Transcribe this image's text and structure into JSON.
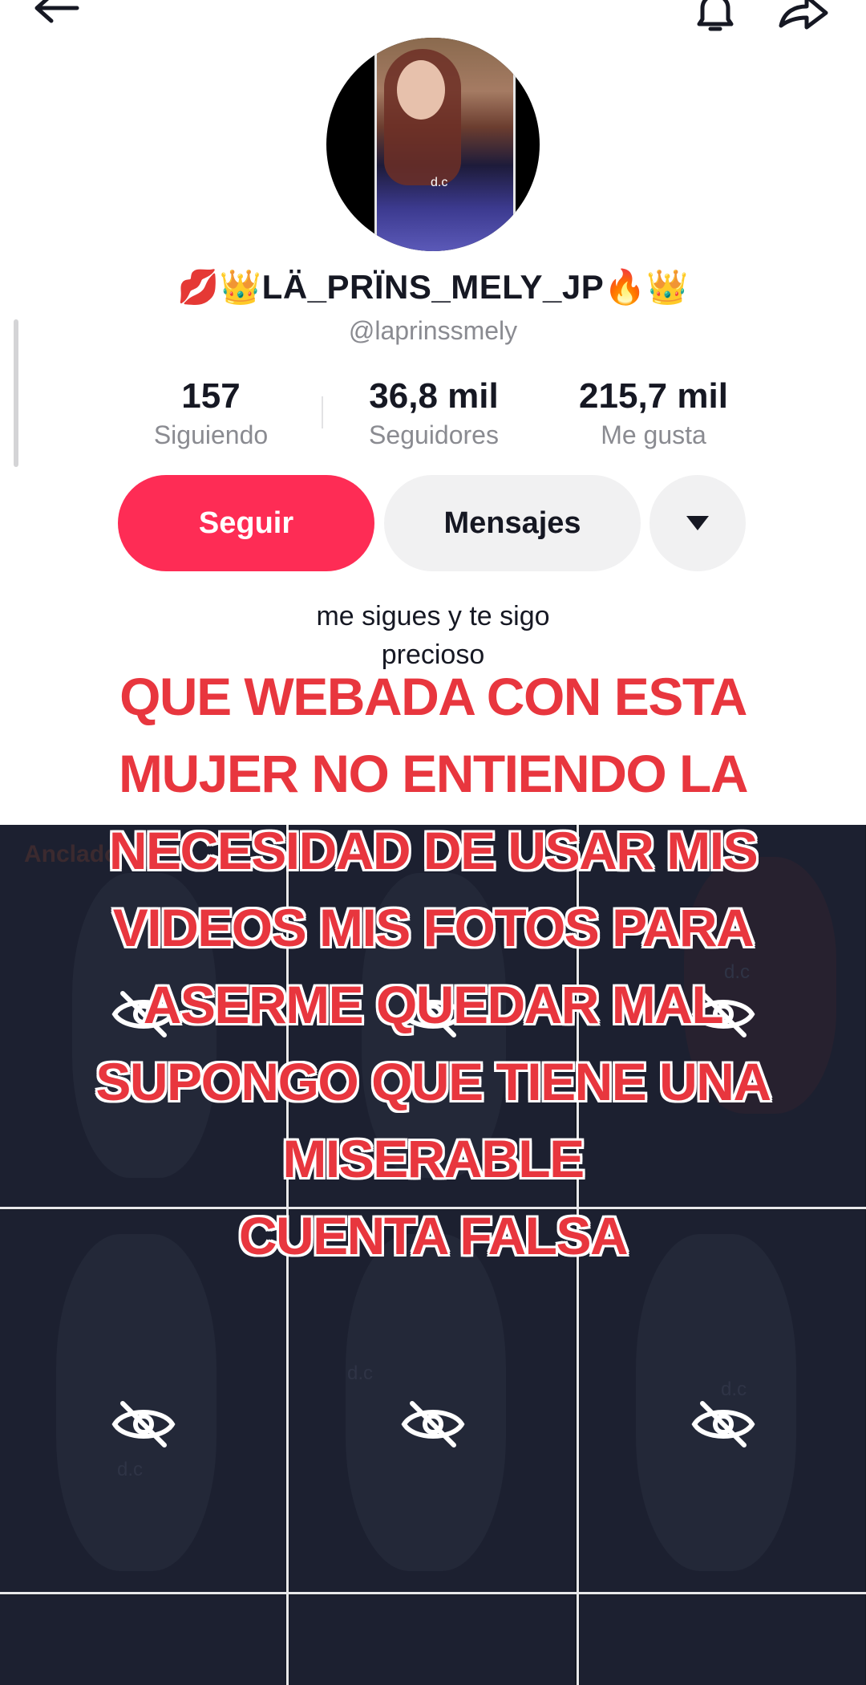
{
  "profile": {
    "display_name": "💋👑LÄ_PRÏNS_MELY_JP🔥👑",
    "username": "@laprinssmely",
    "avatar_watermark": "d.c"
  },
  "stats": [
    {
      "value": "157",
      "label": "Siguiendo"
    },
    {
      "value": "36,8 mil",
      "label": "Seguidores"
    },
    {
      "value": "215,7 mil",
      "label": "Me gusta"
    }
  ],
  "actions": {
    "follow_label": "Seguir",
    "message_label": "Mensajes",
    "more_icon": "triangle-down-icon"
  },
  "bio": [
    "me sigues y te sigo",
    "precioso"
  ],
  "grid": {
    "pinned_label": "Anclado",
    "hidden_icon": "eye-slash-icon",
    "watermark": "d.c"
  },
  "overlay": {
    "lines": [
      "QUE WEBADA CON ESTA",
      "MUJER NO ENTIENDO LA",
      "NECESIDAD DE USAR MIS",
      "VIDEOS MIS FOTOS PARA",
      "ASERME QUEDAR MAL",
      "SUPONGO QUE TIENE UNA",
      "MISERABLE",
      "CUENTA FALSA"
    ]
  },
  "colors": {
    "follow": "#fe2c55",
    "caption": "#e8363e",
    "grid_bg": "#161a24"
  }
}
